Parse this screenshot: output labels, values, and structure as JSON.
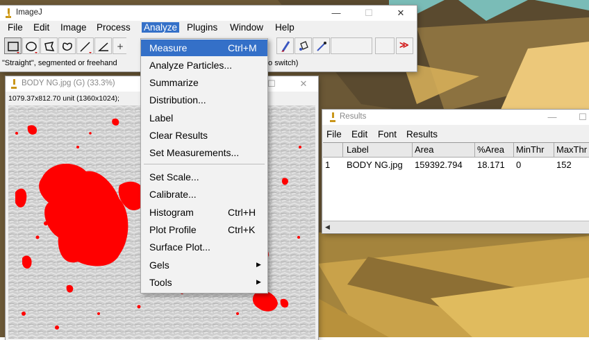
{
  "imagej": {
    "title": "ImageJ",
    "menus": [
      "File",
      "Edit",
      "Image",
      "Process",
      "Analyze",
      "Plugins",
      "Window",
      "Help"
    ],
    "active_menu": "Analyze",
    "status": "\"Straight\", segmented or freehand",
    "status_tail": "to switch)",
    "tools": [
      "rectangle-tool-icon",
      "oval-tool-icon",
      "polygon-tool-icon",
      "freehand-tool-icon",
      "line-tool-icon",
      "angle-tool-icon",
      "point-tool-icon"
    ],
    "right_tools": [
      "brush-tool-icon",
      "flood-fill-tool-icon",
      "color-picker-tool-icon"
    ],
    "more_tools": "≫"
  },
  "analyze_menu": {
    "items": [
      {
        "label": "Measure",
        "shortcut": "Ctrl+M",
        "highlighted": true
      },
      {
        "label": "Analyze Particles...",
        "shortcut": ""
      },
      {
        "label": "Summarize",
        "shortcut": ""
      },
      {
        "label": "Distribution...",
        "shortcut": ""
      },
      {
        "label": "Label",
        "shortcut": ""
      },
      {
        "label": "Clear Results",
        "shortcut": ""
      },
      {
        "label": "Set Measurements...",
        "shortcut": ""
      },
      {
        "label": "Set Scale...",
        "shortcut": ""
      },
      {
        "label": "Calibrate...",
        "shortcut": ""
      },
      {
        "label": "Histogram",
        "shortcut": "Ctrl+H"
      },
      {
        "label": "Plot Profile",
        "shortcut": "Ctrl+K"
      },
      {
        "label": "Surface Plot...",
        "shortcut": ""
      },
      {
        "label": "Gels",
        "shortcut": "",
        "submenu": true
      },
      {
        "label": "Tools",
        "shortcut": "",
        "submenu": true
      }
    ]
  },
  "image_window": {
    "title": "BODY NG.jpg (G) (33.3%)",
    "info": "1079.37x812.70 unit (1360x1024); ",
    "overlay_color": "#ff0000"
  },
  "results": {
    "title": "Results",
    "menus": [
      "File",
      "Edit",
      "Font",
      "Results"
    ],
    "columns": [
      "",
      "Label",
      "Area",
      "%Area",
      "MinThr",
      "MaxThr"
    ],
    "rows": [
      [
        "1",
        "BODY NG.jpg",
        "159392.794",
        "18.171",
        "0",
        "152"
      ]
    ]
  },
  "window_controls": {
    "minimize": "—",
    "maximize": "☐",
    "close": "✕"
  },
  "colors": {
    "accent": "#3470c8",
    "desktop_gold": "#e3b64a",
    "desktop_teal": "#6fc3c3"
  }
}
